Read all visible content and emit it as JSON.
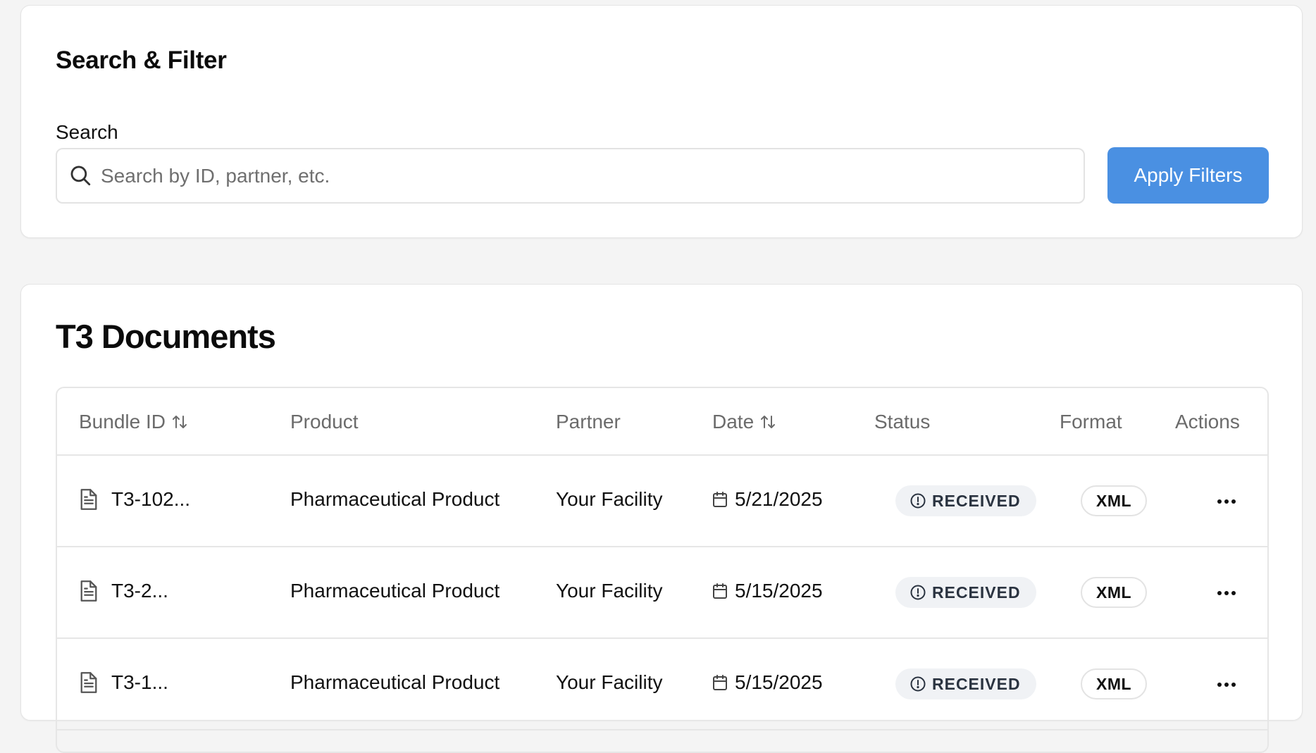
{
  "filter_card": {
    "title": "Search & Filter",
    "search_label": "Search",
    "search_placeholder": "Search by ID, partner, etc.",
    "search_value": "",
    "apply_label": "Apply Filters"
  },
  "colors": {
    "accent": "#4a90e2",
    "status_badge_bg": "#f0f2f5",
    "page_bg": "#f4f4f4"
  },
  "docs_card": {
    "title": "T3 Documents",
    "columns": {
      "bundle_id": "Bundle ID",
      "product": "Product",
      "partner": "Partner",
      "date": "Date",
      "status": "Status",
      "format": "Format",
      "actions": "Actions"
    },
    "rows": [
      {
        "bundle_id": "T3-102...",
        "product": "Pharmaceutical Product",
        "partner": "Your Facility",
        "date": "5/21/2025",
        "status": "RECEIVED",
        "format": "XML",
        "actions_icon": "more-horizontal-icon"
      },
      {
        "bundle_id": "T3-2...",
        "product": "Pharmaceutical Product",
        "partner": "Your Facility",
        "date": "5/15/2025",
        "status": "RECEIVED",
        "format": "XML",
        "actions_icon": "more-horizontal-icon"
      },
      {
        "bundle_id": "T3-1...",
        "product": "Pharmaceutical Product",
        "partner": "Your Facility",
        "date": "5/15/2025",
        "status": "RECEIVED",
        "format": "XML",
        "actions_icon": "more-horizontal-icon"
      }
    ]
  }
}
